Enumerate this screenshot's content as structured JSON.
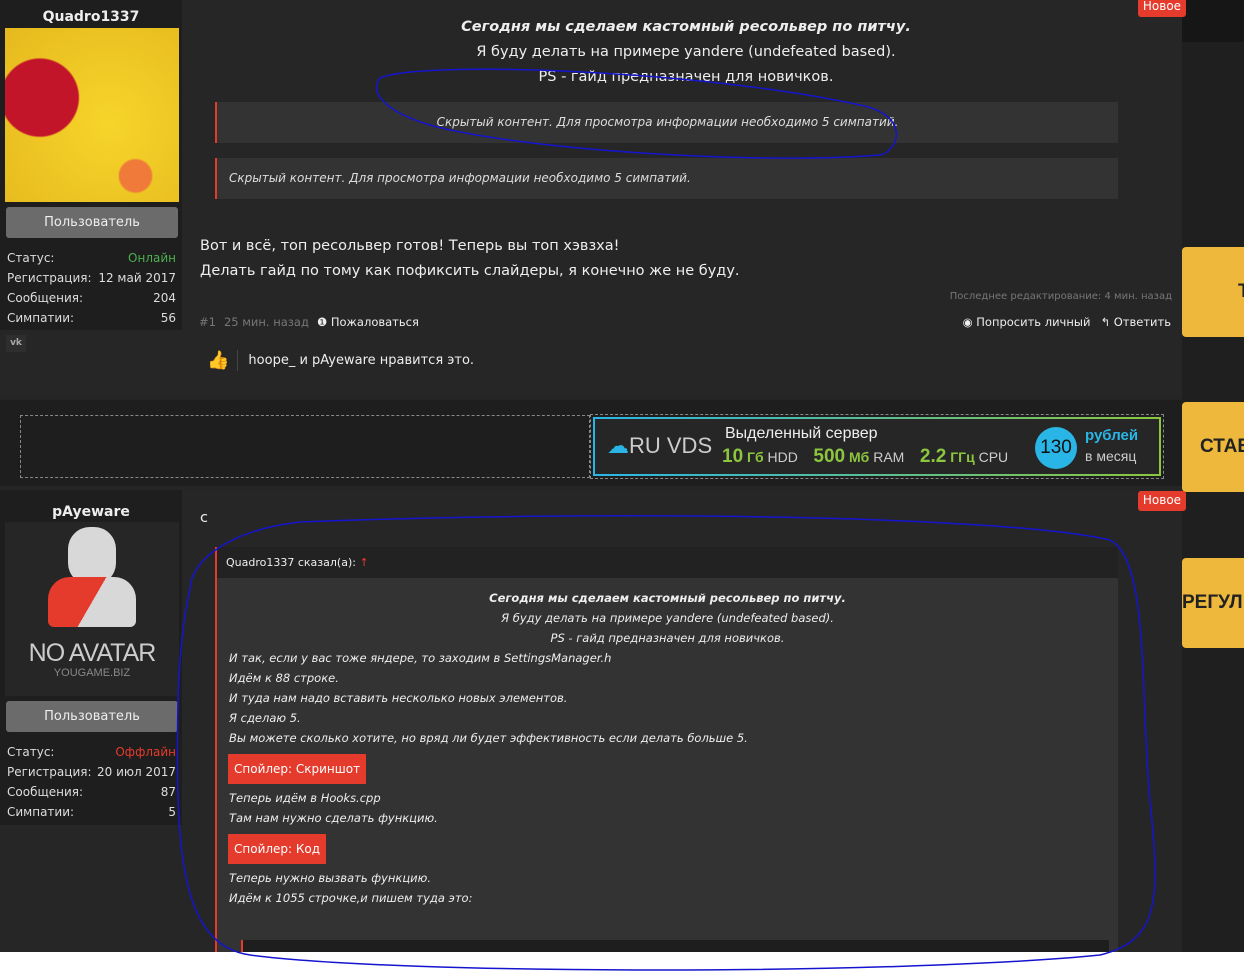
{
  "posts": [
    {
      "user": {
        "name": "Quadro1337",
        "role": "Пользователь",
        "status_label": "Статус:",
        "status": "Онлайн",
        "reg_label": "Регистрация:",
        "reg": "12 май 2017",
        "msgs_label": "Сообщения:",
        "msgs": "204",
        "likes_label": "Симпатии:",
        "likes": "56",
        "social": "vk"
      },
      "badge": "Новое",
      "lines": [
        "Сегодня мы сделаем кастомный ресольвер по питчу.",
        "Я буду делать на примере yandere (undefeated based).",
        "PS - гайд предназначен для новичков."
      ],
      "hidden": [
        "Скрытый контент. Для просмотра информации необходимо 5 симпатий.",
        "Скрытый контент. Для просмотра информации необходимо 5 симпатий."
      ],
      "after": [
        "Вот и всё, топ ресольвер готов! Теперь вы топ хэвзха!",
        "Делать гайд по тому как пофиксить слайдеры, я конечно же не буду."
      ],
      "edited": "Последнее редактирование: 4 мин. назад",
      "number": "#1",
      "time": "25 мин. назад",
      "report": "Пожаловаться",
      "private": "Попросить личный",
      "reply": "Ответить",
      "likes_text": "hoope_ и pAyeware нравится это."
    },
    {
      "user": {
        "name": "pAyeware",
        "role": "Пользователь",
        "status_label": "Статус:",
        "status": "Оффлайн",
        "reg_label": "Регистрация:",
        "reg": "20 июл 2017",
        "msgs_label": "Сообщения:",
        "msgs": "87",
        "likes_label": "Симпатии:",
        "likes": "5",
        "avatar_text": "NO AVATAR",
        "avatar_sub": "YOUGAME.BIZ"
      },
      "badge": "Новое",
      "text": "c",
      "quote": {
        "author": "Quadro1337 сказал(а):",
        "lines": [
          "Сегодня мы сделаем кастомный ресольвер по питчу.",
          "Я буду делать на примере yandere (undefeated based).",
          "PS - гайд предназначен для новичков.",
          "И так, если у вас тоже яндере, то заходим в SettingsManager.h",
          "Идём к 88 строке.",
          "И туда нам надо вставить несколько новых элементов.",
          "Я сделаю 5.",
          "Вы можете сколько хотите, но вряд ли будет эффективность если делать больше 5."
        ],
        "spoiler1": "Спойлер: Скриншот",
        "lines2": [
          "Теперь идём в Hooks.cpp",
          "Там нам нужно сделать функцию."
        ],
        "spoiler2": "Спойлер: Код",
        "lines3": [
          "Теперь нужно вызвать функцию.",
          "Идём к 1055 строчке,и пишем туда это:"
        ]
      }
    }
  ],
  "ad": {
    "brand": "RU VDS",
    "title": "Выделенный сервер",
    "hdd_val": "10",
    "hdd_unit": "Гб",
    "hdd": "HDD",
    "ram_val": "500",
    "ram_unit": "Мб",
    "ram": "RAM",
    "cpu_val": "2.2",
    "cpu_unit": "ГГц",
    "cpu": "CPU",
    "price": "130",
    "price_unit": "рублей",
    "price_period": "в месяц"
  },
  "side_banners": [
    "Т",
    "СТАВ",
    "РЕГУЛ"
  ],
  "colors": {
    "accent": "#e53b2c",
    "online": "#4caf50",
    "offline": "#e53b2c",
    "banner": "#edb83c",
    "ad_green": "#8cc63f",
    "ad_blue": "#29b6e6"
  }
}
